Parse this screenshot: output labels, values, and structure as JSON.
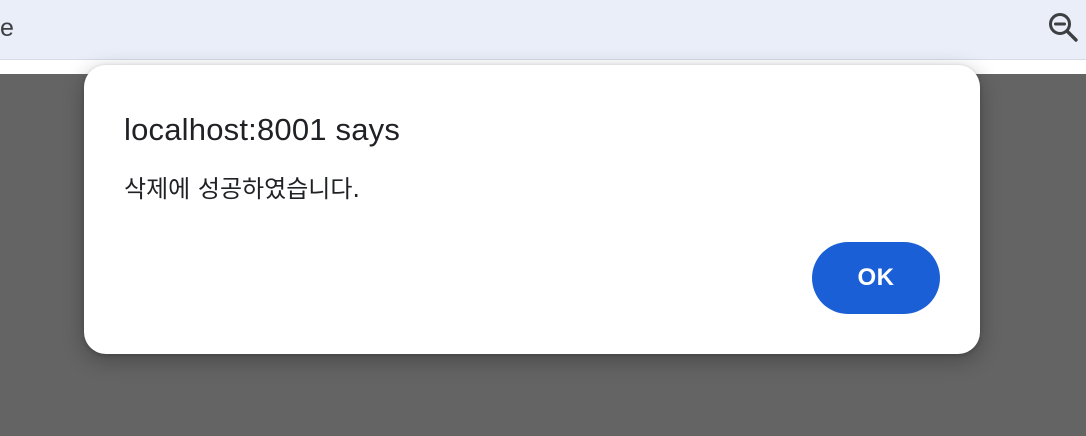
{
  "browser": {
    "address_fragment": "e",
    "zoom_icon": "zoom-out-icon"
  },
  "dialog": {
    "title": "localhost:8001 says",
    "message": "삭제에 성공하였습니다.",
    "ok_label": "OK",
    "accent_color": "#1a5fd6"
  }
}
